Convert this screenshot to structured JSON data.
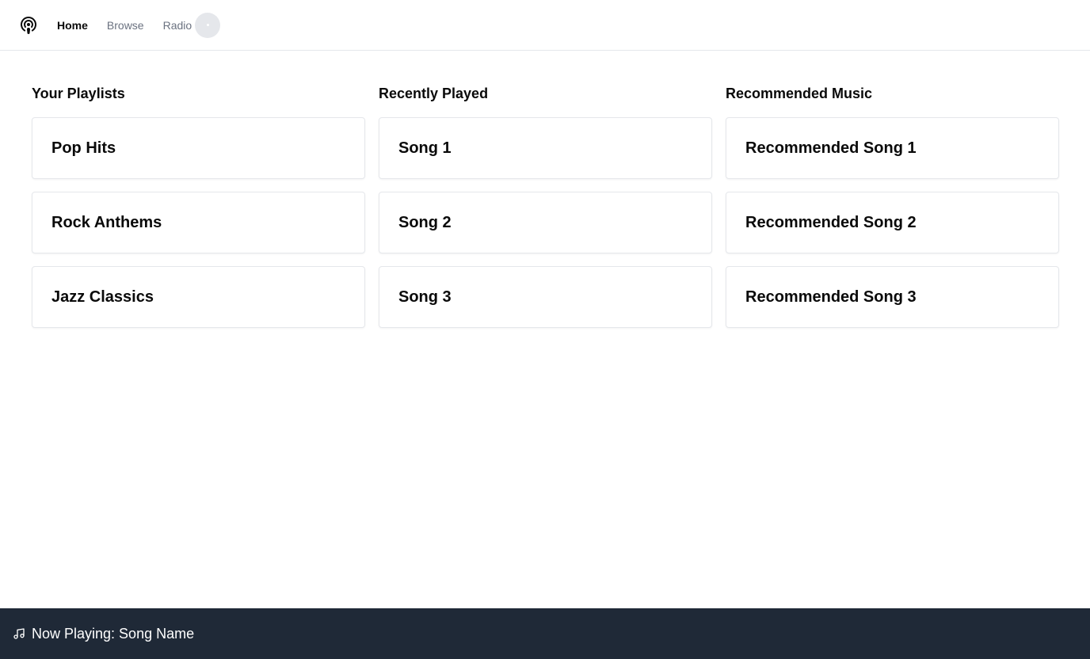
{
  "app": {
    "logo_icon": "podcast-icon"
  },
  "nav": {
    "home_label": "Home",
    "browse_label": "Browse",
    "radio_label": "Radio",
    "active": "Home"
  },
  "columns": {
    "playlists": {
      "title": "Your Playlists",
      "items": [
        "Pop Hits",
        "Rock Anthems",
        "Jazz Classics"
      ]
    },
    "recent": {
      "title": "Recently Played",
      "items": [
        "Song 1",
        "Song 2",
        "Song 3"
      ]
    },
    "recommended": {
      "title": "Recommended Music",
      "items": [
        "Recommended Song 1",
        "Recommended Song 2",
        "Recommended Song 3"
      ]
    }
  },
  "player": {
    "icon": "music-note-icon",
    "text": "Now Playing: Song Name"
  },
  "colors": {
    "player_bg": "#1f2937",
    "border": "#e5e7eb",
    "muted_text": "#6b7280",
    "text": "#0a0a0a"
  }
}
